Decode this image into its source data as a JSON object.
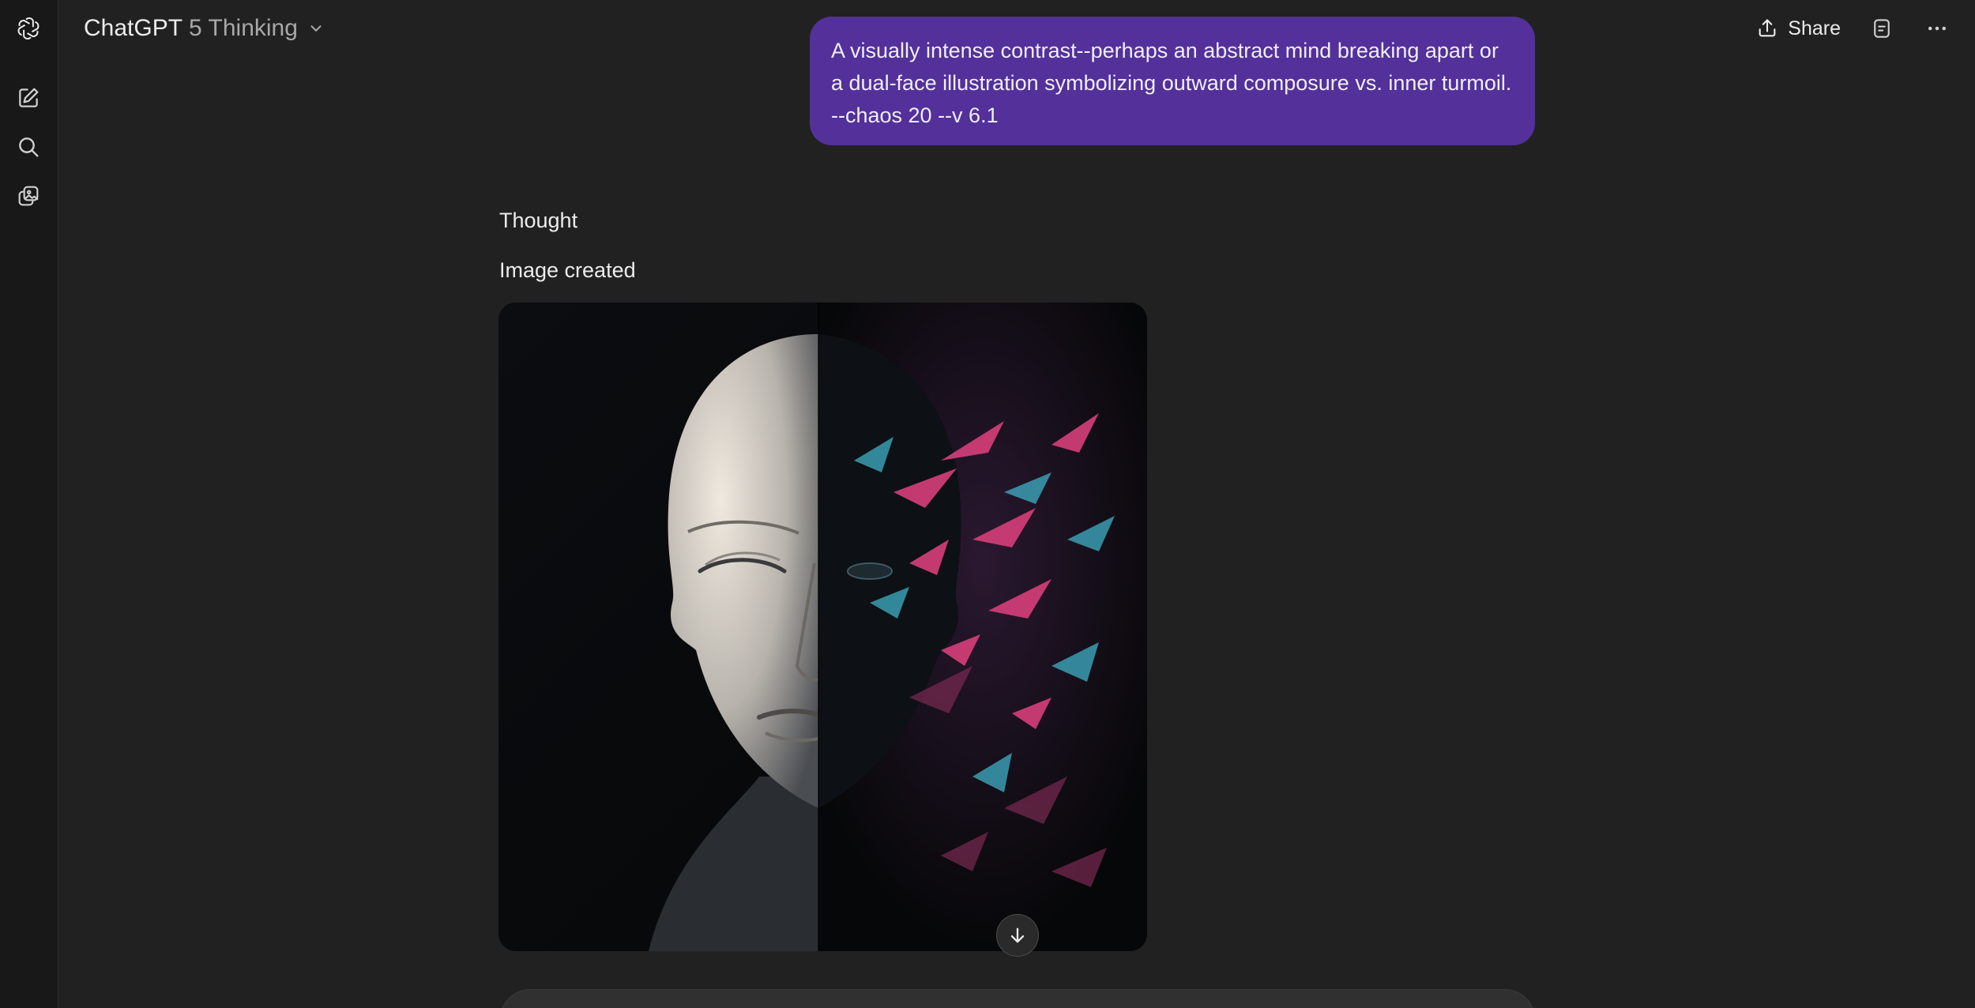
{
  "header": {
    "brand": "ChatGPT",
    "model_variant": "5 Thinking",
    "share_label": "Share"
  },
  "sidebar": {
    "items": [
      {
        "icon": "openai-logo-icon"
      },
      {
        "icon": "new-chat-icon"
      },
      {
        "icon": "search-icon"
      },
      {
        "icon": "image-library-icon"
      }
    ]
  },
  "conversation": {
    "user_message": "A visually intense contrast--perhaps an abstract mind breaking apart or a dual-face illustration symbolizing outward composure vs. inner turmoil. --chaos 20 --v 6.1",
    "thought_label": "Thought",
    "image_status": "Image created"
  },
  "colors": {
    "background": "#212121",
    "user_bubble": "#53309a",
    "rail": "#181818"
  }
}
